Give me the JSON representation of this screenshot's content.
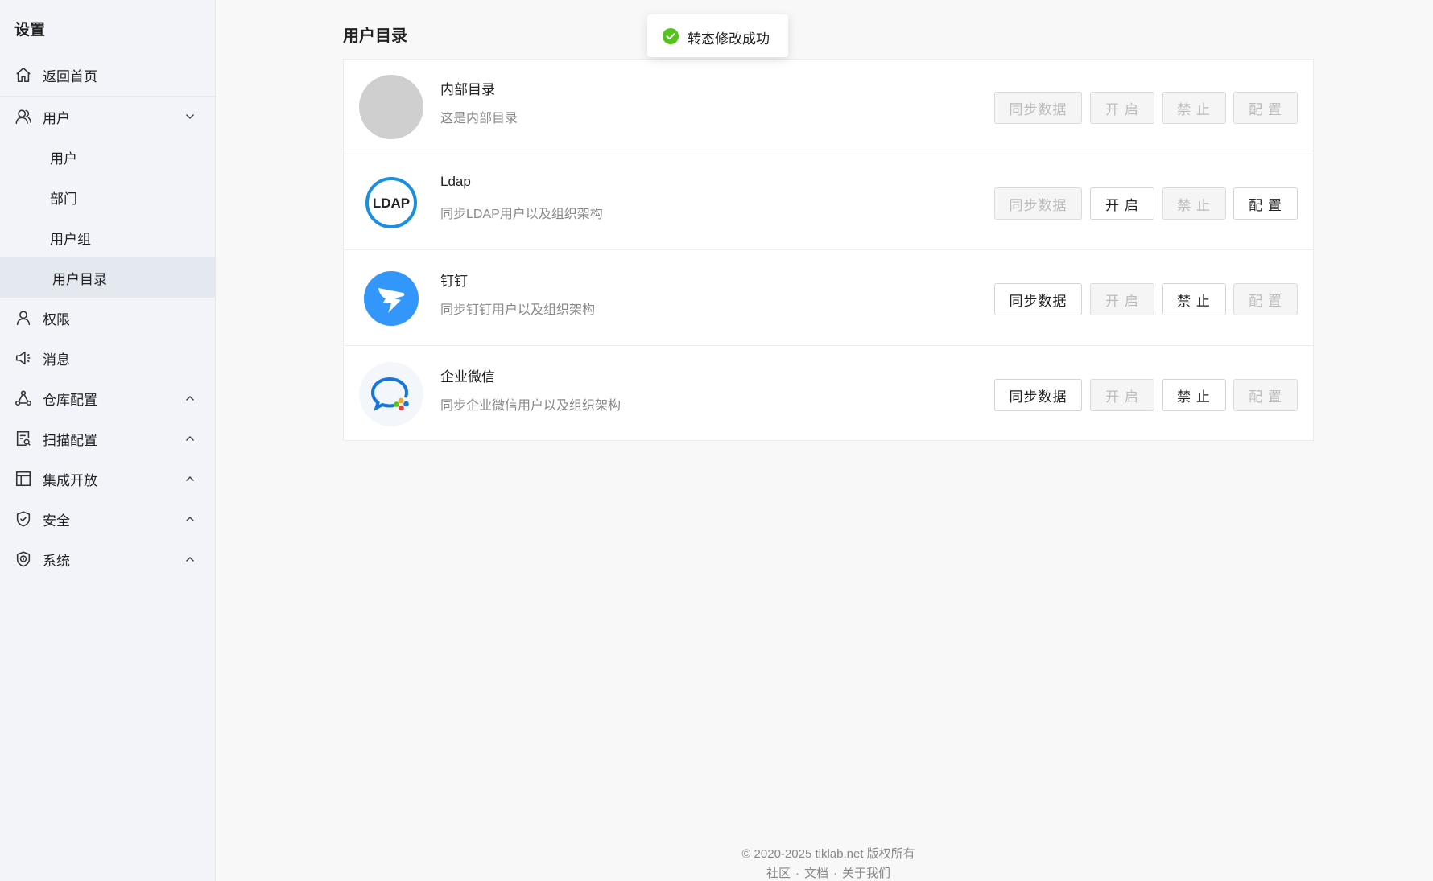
{
  "sidebar": {
    "title": "设置",
    "items": [
      {
        "key": "home",
        "label": "返回首页",
        "icon": "home-icon"
      },
      {
        "key": "user",
        "label": "用户",
        "icon": "user-group-icon",
        "arrow": "chevron-down-icon"
      },
      {
        "key": "perm",
        "label": "权限",
        "icon": "user-icon"
      },
      {
        "key": "msg",
        "label": "消息",
        "icon": "megaphone-icon"
      },
      {
        "key": "repo",
        "label": "仓库配置",
        "icon": "network-icon",
        "arrow": "chevron-up-icon"
      },
      {
        "key": "scan",
        "label": "扫描配置",
        "icon": "scan-doc-icon",
        "arrow": "chevron-up-icon"
      },
      {
        "key": "integ",
        "label": "集成开放",
        "icon": "layout-icon",
        "arrow": "chevron-up-icon"
      },
      {
        "key": "sec",
        "label": "安全",
        "icon": "shield-check-icon",
        "arrow": "chevron-up-icon"
      },
      {
        "key": "sys",
        "label": "系统",
        "icon": "shield-badge-icon",
        "arrow": "chevron-up-icon"
      }
    ],
    "sub_items": [
      {
        "label": "用户"
      },
      {
        "label": "部门"
      },
      {
        "label": "用户组"
      },
      {
        "label": "用户目录",
        "active": true
      }
    ]
  },
  "main": {
    "title": "用户目录",
    "directories": [
      {
        "name": "内部目录",
        "desc": "这是内部目录",
        "logo": "internal-logo",
        "buttons": {
          "sync": "同步数据",
          "open": "开 启",
          "ban": "禁 止",
          "config": "配 置"
        },
        "enabled": {
          "sync": false,
          "open": false,
          "ban": false,
          "config": false
        }
      },
      {
        "name": "Ldap",
        "desc": "同步LDAP用户以及组织架构",
        "logo": "ldap-logo",
        "logo_text": "LDAP",
        "buttons": {
          "sync": "同步数据",
          "open": "开 启",
          "ban": "禁 止",
          "config": "配 置"
        },
        "enabled": {
          "sync": false,
          "open": true,
          "ban": false,
          "config": true
        }
      },
      {
        "name": "钉钉",
        "desc": "同步钉钉用户以及组织架构",
        "logo": "dingtalk-logo",
        "buttons": {
          "sync": "同步数据",
          "open": "开 启",
          "ban": "禁 止",
          "config": "配 置"
        },
        "enabled": {
          "sync": true,
          "open": false,
          "ban": true,
          "config": false
        }
      },
      {
        "name": "企业微信",
        "desc": "同步企业微信用户以及组织架构",
        "logo": "wecom-logo",
        "buttons": {
          "sync": "同步数据",
          "open": "开 启",
          "ban": "禁 止",
          "config": "配 置"
        },
        "enabled": {
          "sync": true,
          "open": false,
          "ban": true,
          "config": false
        }
      }
    ]
  },
  "toast": {
    "text": "转态修改成功",
    "icon": "check-circle-icon",
    "color": "#52c41a"
  },
  "footer": {
    "copyright": "© 2020-2025 tiklab.net 版权所有",
    "links": [
      "社区",
      "文档",
      "关于我们"
    ],
    "separator": "·"
  },
  "colors": {
    "sidebar_bg": "#f2f4f9",
    "active_bg": "#e4e8ef",
    "ldap_blue": "#1a8fe0",
    "dingtalk_blue": "#3296fa"
  }
}
